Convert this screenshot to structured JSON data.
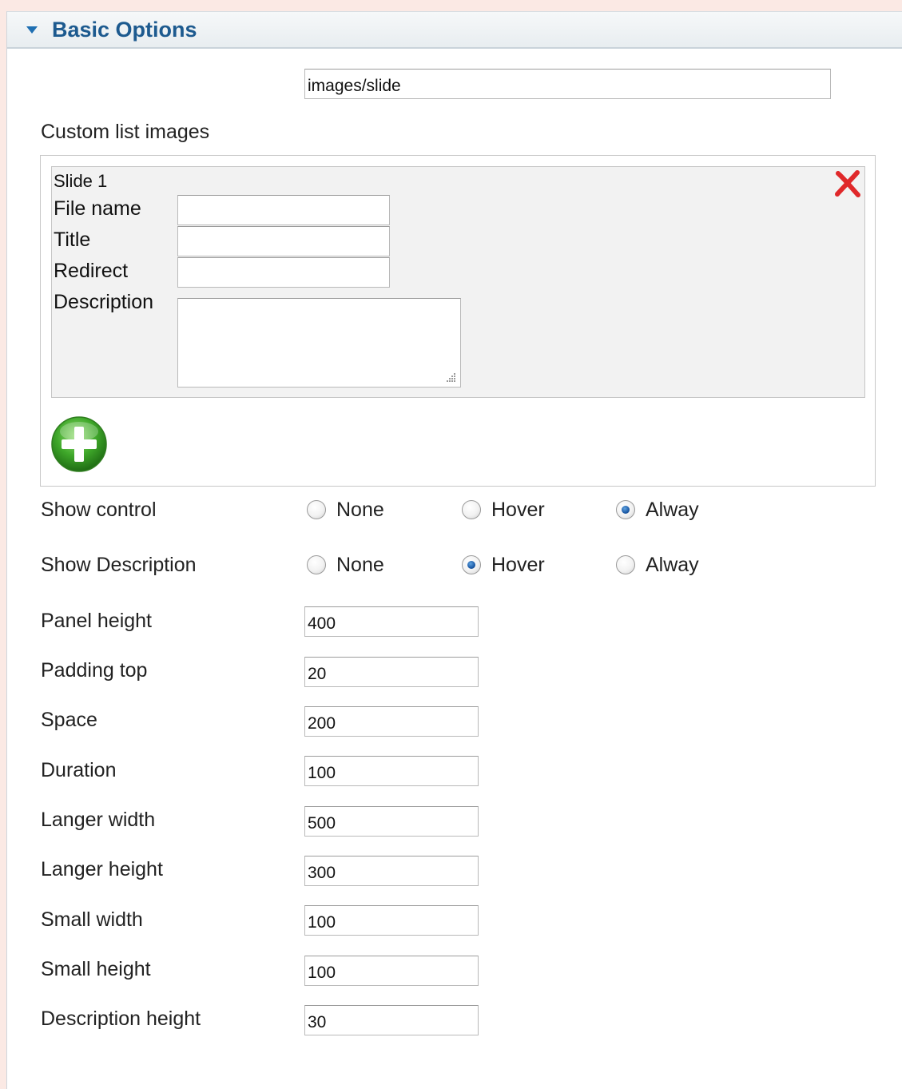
{
  "panel": {
    "title": "Basic Options"
  },
  "image_folder": {
    "value": "images/slide"
  },
  "custom_list": {
    "label": "Custom list images",
    "slide": {
      "title": "Slide 1",
      "file_name_label": "File name",
      "file_name_value": "",
      "title_label": "Title",
      "title_value": "",
      "redirect_label": "Redirect",
      "redirect_value": "",
      "description_label": "Description",
      "description_value": ""
    },
    "icons": {
      "remove": "close-icon",
      "add": "add-icon"
    }
  },
  "show_control": {
    "label": "Show control",
    "options": [
      "None",
      "Hover",
      "Alway"
    ],
    "selected": "Alway"
  },
  "show_description": {
    "label": "Show Description",
    "options": [
      "None",
      "Hover",
      "Alway"
    ],
    "selected": "Hover"
  },
  "fields": [
    {
      "label": "Panel height",
      "value": "400"
    },
    {
      "label": "Padding top",
      "value": "20"
    },
    {
      "label": "Space",
      "value": "200"
    },
    {
      "label": "Duration",
      "value": "100"
    },
    {
      "label": "Langer width",
      "value": "500"
    },
    {
      "label": "Langer height",
      "value": "300"
    },
    {
      "label": "Small width",
      "value": "100"
    },
    {
      "label": "Small height",
      "value": "100"
    },
    {
      "label": "Description height",
      "value": "30"
    }
  ],
  "colors": {
    "page_background": "#fbe9e4",
    "header_title": "#1d5a8f",
    "radio_checked": "#1c5aa6",
    "remove_icon": "#e0282a",
    "add_icon": "#3fa82a"
  }
}
